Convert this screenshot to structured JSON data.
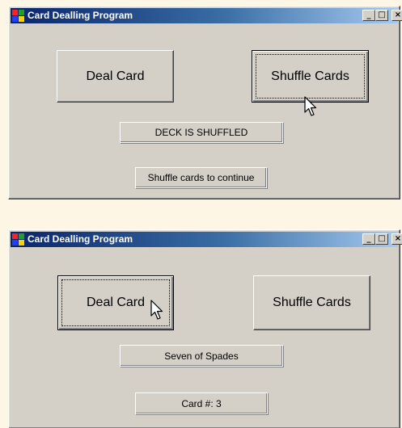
{
  "windows": [
    {
      "title": "Card Dealling Program",
      "caption_buttons": {
        "minimize": "_",
        "maximize": "□",
        "close": "×"
      },
      "deal_button_label": "Deal Card",
      "shuffle_button_label": "Shuffle Cards",
      "status_text": "DECK IS SHUFFLED",
      "info_text": "Shuffle cards to continue"
    },
    {
      "title": "Card Dealling Program",
      "caption_buttons": {
        "minimize": "_",
        "maximize": "□",
        "close": "×"
      },
      "deal_button_label": "Deal Card",
      "shuffle_button_label": "Shuffle Cards",
      "status_text": "Seven of Spades",
      "info_text": "Card #: 3"
    }
  ],
  "colors": {
    "titlebar_start": "#0a246a",
    "titlebar_end": "#a6caf0",
    "window_face": "#d4d0c8",
    "page_background": "#fdf6e4"
  },
  "icons": [
    "app-icon",
    "minimize-icon",
    "maximize-icon",
    "close-icon",
    "mouse-pointer-icon"
  ]
}
